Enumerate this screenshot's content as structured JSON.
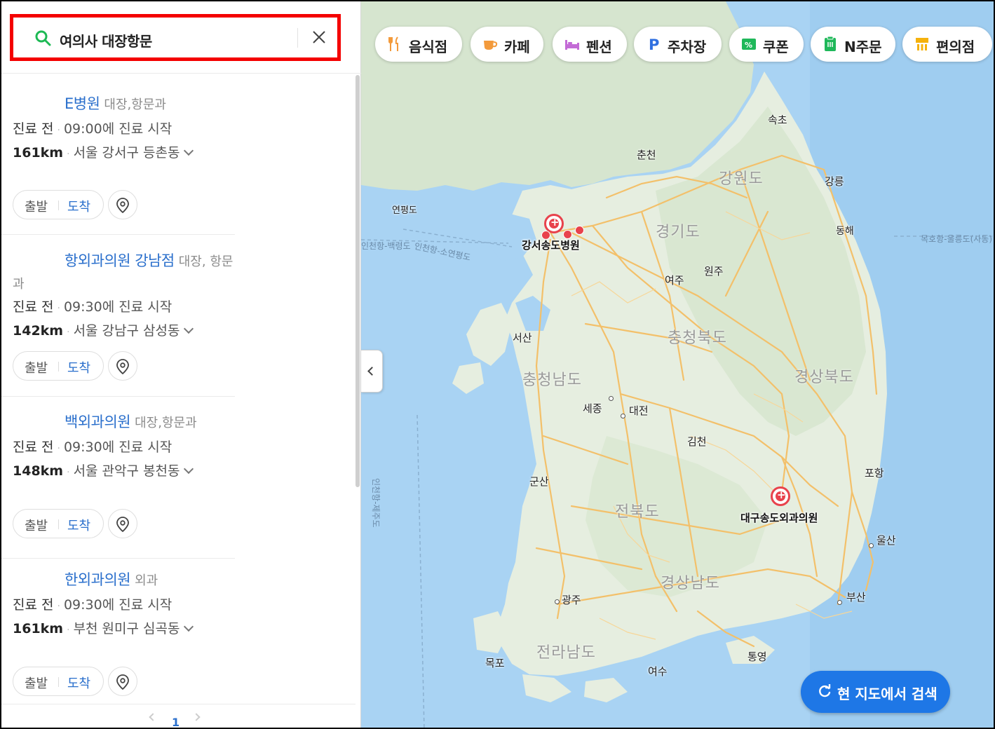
{
  "search": {
    "query": "여의사 대장항문"
  },
  "results": [
    {
      "name": "E병원",
      "category": "대장,항문과",
      "status": "진료 전",
      "hours": "09:00에 진료 시작",
      "distance": "161km",
      "address": "서울 강서구 등촌동",
      "depart": "출발",
      "arrive": "도착"
    },
    {
      "name": "항외과의원 강남점",
      "category": "대장, 항문과",
      "status": "진료 전",
      "hours": "09:30에 진료 시작",
      "distance": "142km",
      "address": "서울 강남구 삼성동",
      "depart": "출발",
      "arrive": "도착"
    },
    {
      "name": "백외과의원",
      "category": "대장,항문과",
      "status": "진료 전",
      "hours": "09:30에 진료 시작",
      "distance": "148km",
      "address": "서울 관악구 봉천동",
      "depart": "출발",
      "arrive": "도착"
    },
    {
      "name": "한외과의원",
      "category": "외과",
      "status": "진료 전",
      "hours": "09:30에 진료 시작",
      "distance": "161km",
      "address": "부천 원미구 심곡동",
      "depart": "출발",
      "arrive": "도착"
    }
  ],
  "pager": {
    "current": "1"
  },
  "chips": [
    {
      "label": "음식점",
      "icon": "fork-knife-icon",
      "color": "#f39a3b"
    },
    {
      "label": "카페",
      "icon": "coffee-cup-icon",
      "color": "#f39a3b"
    },
    {
      "label": "펜션",
      "icon": "bed-icon",
      "color": "#c36bd6"
    },
    {
      "label": "주차장",
      "icon": "parking-icon",
      "color": "#2f6fe0"
    },
    {
      "label": "쿠폰",
      "icon": "coupon-icon",
      "color": "#1fb85a"
    },
    {
      "label": "N주문",
      "icon": "order-icon",
      "color": "#1fb85a"
    },
    {
      "label": "편의점",
      "icon": "store-icon",
      "color": "#f5b20c"
    }
  ],
  "map": {
    "regions": [
      "강원도",
      "경기도",
      "충청북도",
      "충청남도",
      "경상북도",
      "전북도",
      "경상남도",
      "전라남도"
    ],
    "cities": [
      "속초",
      "춘천",
      "강릉",
      "연평도",
      "동해",
      "여주",
      "원주",
      "서산",
      "세종",
      "대전",
      "김천",
      "군산",
      "포항",
      "울산",
      "광주",
      "부산",
      "통영",
      "목포",
      "여수"
    ],
    "sea_labels": [
      "목호항-울릉도(사동)",
      "인천항-백령도",
      "인천항-소연평도",
      "인천항-제주도"
    ],
    "markers": [
      "강서송도병원",
      "대구송도외과의원"
    ],
    "search_here": "현 지도에서 검색"
  },
  "colors": {
    "accent": "#2a6fcc",
    "highlight_border": "#f40000",
    "marker": "#e8424c",
    "sea": "#a9d3f3",
    "land": "#dfeadb",
    "road": "#f3c06a"
  }
}
